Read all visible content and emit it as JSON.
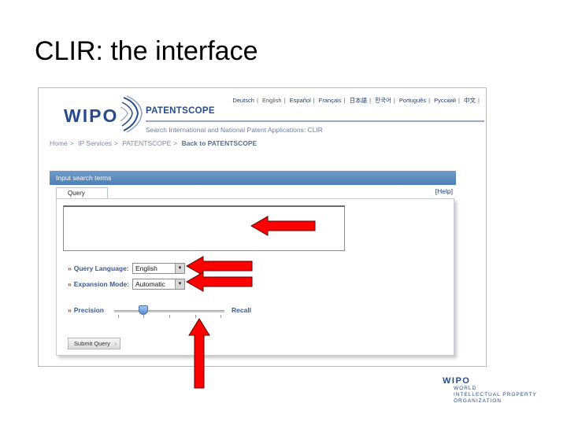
{
  "slide": {
    "title": "CLIR: the interface"
  },
  "header": {
    "languages": [
      "Deutsch",
      "English",
      "Español",
      "Français",
      "日本語",
      "한국어",
      "Português",
      "Русский",
      "中文"
    ],
    "logo": "WIPO",
    "product": "PATENTSCOPE",
    "subtitle": "Search International and National Patent Applications: CLIR"
  },
  "breadcrumb": {
    "items": [
      "Home",
      "IP Services",
      "PATENTSCOPE"
    ],
    "current": "Back to PATENTSCOPE",
    "separator": ">"
  },
  "panel": {
    "title": "Input search terms",
    "tab": "Query",
    "help": "[Help]"
  },
  "form": {
    "query_value": "",
    "query_language_label": "Query Language:",
    "query_language_value": "English",
    "expansion_mode_label": "Expansion Mode:",
    "expansion_mode_value": "Automatic",
    "precision_label": "Precision",
    "recall_label": "Recall",
    "submit_label": "Submit Query",
    "bullet": "»",
    "slider_value": 0.25
  },
  "footer": {
    "logo": "WIPO",
    "lines": [
      "WORLD",
      "INTELLECTUAL PROPERTY",
      "ORGANIZATION"
    ]
  },
  "colors": {
    "arrow": "#ff0000",
    "panel_header": "#5a86bb",
    "link": "#1f3d77"
  }
}
